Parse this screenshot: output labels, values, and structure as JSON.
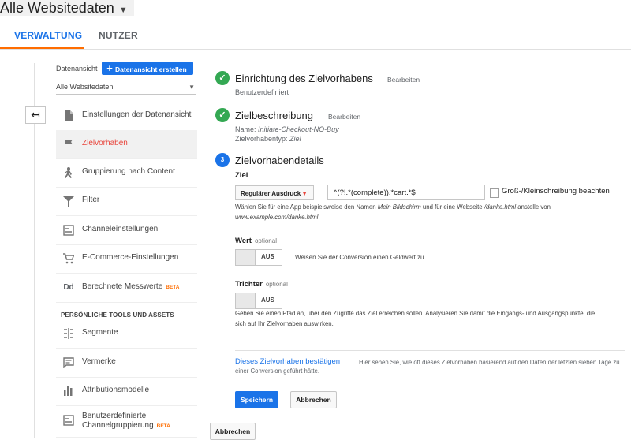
{
  "header": {
    "view_selector": "Alle Websitedaten",
    "tabs": [
      {
        "label": "VERWALTUNG"
      },
      {
        "label": "NUTZER"
      }
    ]
  },
  "sidebar": {
    "view_label": "Datenansicht",
    "create_view_button": "Datenansicht erstellen",
    "view_select_value": "Alle Websitedaten",
    "items": [
      {
        "label": "Einstellungen der Datenansicht",
        "icon": "document-icon"
      },
      {
        "label": "Zielvorhaben",
        "icon": "flag-icon"
      },
      {
        "label": "Gruppierung nach Content",
        "icon": "person-walk-icon"
      },
      {
        "label": "Filter",
        "icon": "funnel-icon"
      },
      {
        "label": "Channeleinstellungen",
        "icon": "channel-settings-icon"
      },
      {
        "label": "E-Commerce-Einstellungen",
        "icon": "cart-icon"
      },
      {
        "label": "Berechnete Messwerte",
        "icon": "dd-icon",
        "badge": "BETA"
      }
    ],
    "section_heading": "PERSÖNLICHE TOOLS UND ASSETS",
    "personal_items": [
      {
        "label": "Segmente",
        "icon": "segments-icon"
      },
      {
        "label": "Vermerke",
        "icon": "comment-icon"
      },
      {
        "label": "Attributionsmodelle",
        "icon": "bar-chart-icon"
      },
      {
        "label": "Benutzerdefinierte Channelgruppierung",
        "label_line1": "Benutzerdefinierte",
        "label_line2": "Channelgruppierung",
        "icon": "channel-group-icon",
        "badge": "BETA"
      }
    ]
  },
  "steps": {
    "setup": {
      "title": "Einrichtung des Zielvorhabens",
      "edit": "Bearbeiten",
      "value": "Benutzerdefiniert"
    },
    "description": {
      "title": "Zielbeschreibung",
      "edit": "Bearbeiten",
      "name_label": "Name:",
      "name_value": "Initiate-Checkout-NO-Buy",
      "type_label": "Zielvorhabentyp:",
      "type_value": "Ziel"
    },
    "details": {
      "number": "3",
      "title": "Zielvorhabendetails",
      "goal_label": "Ziel",
      "match_type": "Regulärer Ausdruck",
      "regex_value": "^(?!.*(complete)).*cart.*$",
      "case_sensitive_label": "Groß-/Kleinschreibung beachten",
      "help_pre": "Wählen Sie für eine App beispielsweise den Namen ",
      "help_app": "Mein Bildschirm",
      "help_mid": " und für eine Webseite ",
      "help_page": "/danke.html",
      "help_post": " anstelle von",
      "help_example": "www.example.com/danke.html",
      "help_end": ".",
      "value_label": "Wert",
      "value_optional": "optional",
      "value_toggle": "AUS",
      "value_desc": "Weisen Sie der Conversion einen Geldwert zu.",
      "funnel_label": "Trichter",
      "funnel_optional": "optional",
      "funnel_toggle": "AUS",
      "funnel_desc_line1": "Geben Sie einen Pfad an, über den Zugriffe das Ziel erreichen sollen. Analysieren Sie damit die Eingangs- und Ausgangspunkte, die",
      "funnel_desc_line2": "sich auf Ihr Zielvorhaben auswirken.",
      "verify_link": "Dieses Zielvorhaben bestätigen",
      "verify_desc": "Hier sehen Sie, wie oft dieses Zielvorhaben basierend auf den Daten der letzten sieben Tage zu einer Conversion geführt hätte."
    }
  },
  "actions": {
    "save": "Speichern",
    "cancel": "Abbrechen",
    "cancel_bottom": "Abbrechen"
  },
  "colors": {
    "accent": "#1a73e8",
    "success": "#34a853",
    "tab_underline": "#ff6d00",
    "active_item": "#e8453c"
  }
}
